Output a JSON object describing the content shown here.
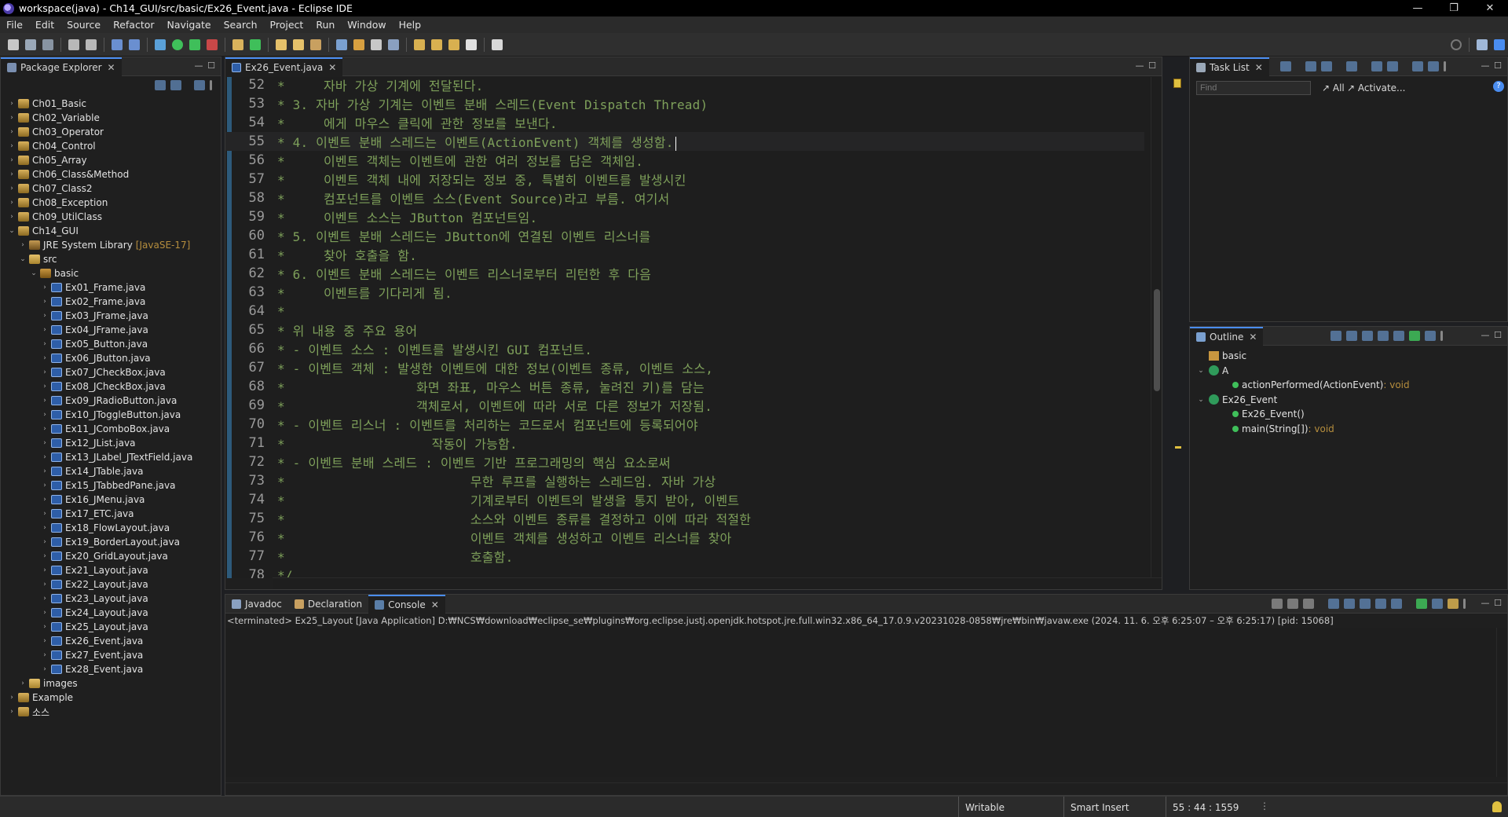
{
  "window": {
    "title": "workspace(java) - Ch14_GUI/src/basic/Ex26_Event.java - Eclipse IDE",
    "minimize": "—",
    "restore": "❐",
    "close": "✕"
  },
  "menu": [
    "File",
    "Edit",
    "Source",
    "Refactor",
    "Navigate",
    "Search",
    "Project",
    "Run",
    "Window",
    "Help"
  ],
  "package_explorer": {
    "tab_label": "Package Explorer",
    "items": [
      {
        "label": "Ch01_Basic",
        "level": 0,
        "arrow": "›",
        "type": "project"
      },
      {
        "label": "Ch02_Variable",
        "level": 0,
        "arrow": "›",
        "type": "project"
      },
      {
        "label": "Ch03_Operator",
        "level": 0,
        "arrow": "›",
        "type": "project"
      },
      {
        "label": "Ch04_Control",
        "level": 0,
        "arrow": "›",
        "type": "project"
      },
      {
        "label": "Ch05_Array",
        "level": 0,
        "arrow": "›",
        "type": "project"
      },
      {
        "label": "Ch06_Class&Method",
        "level": 0,
        "arrow": "›",
        "type": "project"
      },
      {
        "label": "Ch07_Class2",
        "level": 0,
        "arrow": "›",
        "type": "project"
      },
      {
        "label": "Ch08_Exception",
        "level": 0,
        "arrow": "›",
        "type": "project"
      },
      {
        "label": "Ch09_UtilClass",
        "level": 0,
        "arrow": "›",
        "type": "project"
      },
      {
        "label": "Ch14_GUI",
        "level": 0,
        "arrow": "⌄",
        "type": "project"
      },
      {
        "label": "JRE System Library",
        "level": 1,
        "arrow": "›",
        "type": "lib",
        "deco": "[JavaSE-17]"
      },
      {
        "label": "src",
        "level": 1,
        "arrow": "⌄",
        "type": "folder"
      },
      {
        "label": "basic",
        "level": 2,
        "arrow": "⌄",
        "type": "package"
      },
      {
        "label": "Ex01_Frame.java",
        "level": 3,
        "arrow": "›",
        "type": "java"
      },
      {
        "label": "Ex02_Frame.java",
        "level": 3,
        "arrow": "›",
        "type": "java"
      },
      {
        "label": "Ex03_JFrame.java",
        "level": 3,
        "arrow": "›",
        "type": "java"
      },
      {
        "label": "Ex04_JFrame.java",
        "level": 3,
        "arrow": "›",
        "type": "java"
      },
      {
        "label": "Ex05_Button.java",
        "level": 3,
        "arrow": "›",
        "type": "java"
      },
      {
        "label": "Ex06_JButton.java",
        "level": 3,
        "arrow": "›",
        "type": "java"
      },
      {
        "label": "Ex07_JCheckBox.java",
        "level": 3,
        "arrow": "›",
        "type": "java"
      },
      {
        "label": "Ex08_JCheckBox.java",
        "level": 3,
        "arrow": "›",
        "type": "java"
      },
      {
        "label": "Ex09_JRadioButton.java",
        "level": 3,
        "arrow": "›",
        "type": "java"
      },
      {
        "label": "Ex10_JToggleButton.java",
        "level": 3,
        "arrow": "›",
        "type": "java"
      },
      {
        "label": "Ex11_JComboBox.java",
        "level": 3,
        "arrow": "›",
        "type": "java"
      },
      {
        "label": "Ex12_JList.java",
        "level": 3,
        "arrow": "›",
        "type": "java"
      },
      {
        "label": "Ex13_JLabel_JTextField.java",
        "level": 3,
        "arrow": "›",
        "type": "java"
      },
      {
        "label": "Ex14_JTable.java",
        "level": 3,
        "arrow": "›",
        "type": "java"
      },
      {
        "label": "Ex15_JTabbedPane.java",
        "level": 3,
        "arrow": "›",
        "type": "java"
      },
      {
        "label": "Ex16_JMenu.java",
        "level": 3,
        "arrow": "›",
        "type": "java"
      },
      {
        "label": "Ex17_ETC.java",
        "level": 3,
        "arrow": "›",
        "type": "java"
      },
      {
        "label": "Ex18_FlowLayout.java",
        "level": 3,
        "arrow": "›",
        "type": "java"
      },
      {
        "label": "Ex19_BorderLayout.java",
        "level": 3,
        "arrow": "›",
        "type": "java"
      },
      {
        "label": "Ex20_GridLayout.java",
        "level": 3,
        "arrow": "›",
        "type": "java"
      },
      {
        "label": "Ex21_Layout.java",
        "level": 3,
        "arrow": "›",
        "type": "java"
      },
      {
        "label": "Ex22_Layout.java",
        "level": 3,
        "arrow": "›",
        "type": "java"
      },
      {
        "label": "Ex23_Layout.java",
        "level": 3,
        "arrow": "›",
        "type": "java"
      },
      {
        "label": "Ex24_Layout.java",
        "level": 3,
        "arrow": "›",
        "type": "java"
      },
      {
        "label": "Ex25_Layout.java",
        "level": 3,
        "arrow": "›",
        "type": "java"
      },
      {
        "label": "Ex26_Event.java",
        "level": 3,
        "arrow": "›",
        "type": "java"
      },
      {
        "label": "Ex27_Event.java",
        "level": 3,
        "arrow": "›",
        "type": "java"
      },
      {
        "label": "Ex28_Event.java",
        "level": 3,
        "arrow": "›",
        "type": "java"
      },
      {
        "label": "images",
        "level": 1,
        "arrow": "›",
        "type": "folder"
      },
      {
        "label": "Example",
        "level": 0,
        "arrow": "›",
        "type": "project"
      },
      {
        "label": "소스",
        "level": 0,
        "arrow": "›",
        "type": "project"
      }
    ]
  },
  "editor": {
    "tab_label": "Ex26_Event.java",
    "current_line": 55,
    "lines": [
      {
        "n": "52",
        "text": "*     자바 가상 기계에 전달된다."
      },
      {
        "n": "53",
        "text": "* 3. 자바 가상 기계는 이벤트 분배 스레드(Event Dispatch Thread)"
      },
      {
        "n": "54",
        "text": "*     에게 마우스 클릭에 관한 정보를 보낸다."
      },
      {
        "n": "55",
        "text": "* 4. 이벤트 분배 스레드는 이벤트(ActionEvent) 객체를 생성함."
      },
      {
        "n": "56",
        "text": "*     이벤트 객체는 이벤트에 관한 여러 정보를 담은 객체임."
      },
      {
        "n": "57",
        "text": "*     이벤트 객체 내에 저장되는 정보 중, 특별히 이벤트를 발생시킨"
      },
      {
        "n": "58",
        "text": "*     컴포넌트를 이벤트 소스(Event Source)라고 부름. 여기서"
      },
      {
        "n": "59",
        "text": "*     이벤트 소스는 JButton 컴포넌트임."
      },
      {
        "n": "60",
        "text": "* 5. 이벤트 분배 스레드는 JButton에 연결된 이벤트 리스너를"
      },
      {
        "n": "61",
        "text": "*     찾아 호출을 함."
      },
      {
        "n": "62",
        "text": "* 6. 이벤트 분배 스레드는 이벤트 리스너로부터 리턴한 후 다음"
      },
      {
        "n": "63",
        "text": "*     이벤트를 기다리게 됨."
      },
      {
        "n": "64",
        "text": "*"
      },
      {
        "n": "65",
        "text": "* 위 내용 중 주요 용어"
      },
      {
        "n": "66",
        "text": "* - 이벤트 소스 : 이벤트를 발생시킨 GUI 컴포넌트."
      },
      {
        "n": "67",
        "text": "* - 이벤트 객체 : 발생한 이벤트에 대한 정보(이벤트 종류, 이벤트 소스,"
      },
      {
        "n": "68",
        "text": "*                 화면 좌표, 마우스 버튼 종류, 눌려진 키)를 담는"
      },
      {
        "n": "69",
        "text": "*                 객체로서, 이벤트에 따라 서로 다른 정보가 저장됨."
      },
      {
        "n": "70",
        "text": "* - 이벤트 리스너 : 이벤트를 처리하는 코드로서 컴포넌트에 등록되어야"
      },
      {
        "n": "71",
        "text": "*                   작동이 가능함."
      },
      {
        "n": "72",
        "text": "* - 이벤트 분배 스레드 : 이벤트 기반 프로그래밍의 핵심 요소로써"
      },
      {
        "n": "73",
        "text": "*                        무한 루프를 실행하는 스레드임. 자바 가상"
      },
      {
        "n": "74",
        "text": "*                        기계로부터 이벤트의 발생을 통지 받아, 이벤트"
      },
      {
        "n": "75",
        "text": "*                        소스와 이벤트 종류를 결정하고 이에 따라 적절한"
      },
      {
        "n": "76",
        "text": "*                        이벤트 객체를 생성하고 이벤트 리스너를 찾아"
      },
      {
        "n": "77",
        "text": "*                        호출함."
      },
      {
        "n": "78",
        "text": "*/"
      }
    ]
  },
  "task_list": {
    "tab_label": "Task List",
    "find_placeholder": "Find",
    "all_label": "All",
    "activate_label": "Activate..."
  },
  "outline": {
    "tab_label": "Outline",
    "items": [
      {
        "label": "basic",
        "level": 0,
        "arrow": "",
        "icon": "package",
        "ret": ""
      },
      {
        "label": "A",
        "level": 0,
        "arrow": "⌄",
        "icon": "class",
        "ret": ""
      },
      {
        "label": "actionPerformed(ActionEvent)",
        "level": 1,
        "arrow": "",
        "icon": "method",
        "ret": " : void"
      },
      {
        "label": "Ex26_Event",
        "level": 0,
        "arrow": "⌄",
        "icon": "class",
        "ret": ""
      },
      {
        "label": "Ex26_Event()",
        "level": 1,
        "arrow": "",
        "icon": "method",
        "ret": ""
      },
      {
        "label": "main(String[])",
        "level": 1,
        "arrow": "",
        "icon": "method",
        "ret": " : void"
      }
    ]
  },
  "bottom_tabs": {
    "javadoc": "Javadoc",
    "declaration": "Declaration",
    "console": "Console"
  },
  "console": {
    "status": "<terminated> Ex25_Layout [Java Application] D:₩NCS₩download₩eclipse_se₩plugins₩org.eclipse.justj.openjdk.hotspot.jre.full.win32.x86_64_17.0.9.v20231028-0858₩jre₩bin₩javaw.exe  (2024. 11. 6. 오후 6:25:07 – 오후 6:25:17) [pid: 15068]"
  },
  "statusbar": {
    "writable": "Writable",
    "insert_mode": "Smart Insert",
    "position": "55 : 44 : 1559"
  },
  "colors": {
    "comment": "#7ea05a",
    "accent": "#4a8df0"
  }
}
